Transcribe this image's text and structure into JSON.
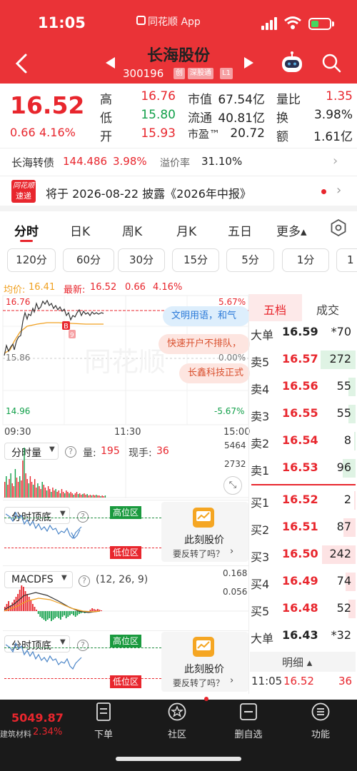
{
  "status_bar": {
    "time": "11:05",
    "app_label": "同花顺 App"
  },
  "header": {
    "back_icon": "back-arrow-icon",
    "stock_name": "长海股份",
    "stock_code": "300196",
    "badges": [
      "创",
      "深股通",
      "L1"
    ]
  },
  "quote": {
    "price": "16.52",
    "change": "0.66",
    "change_pct": "4.16%",
    "rows": [
      {
        "l1": "高",
        "v1": "16.76",
        "l2": "市值",
        "v2": "67.54亿",
        "l3": "量比",
        "v3": "1.35"
      },
      {
        "l1": "低",
        "v1": "15.80",
        "l2": "流通",
        "v2": "40.81亿",
        "l3": "换",
        "v3": "3.98%"
      },
      {
        "l1": "开",
        "v1": "15.93",
        "l2": "市盈™",
        "v2": "20.72",
        "l3": "额",
        "v3": "1.61亿"
      }
    ]
  },
  "convertible": {
    "name": "长海转债",
    "price": "144.486",
    "pct": "3.98%",
    "premium_label": "溢价率",
    "premium": "31.10%"
  },
  "news": {
    "logo_top": "同花顺",
    "logo_bottom": "速递",
    "text": "将于 2026-08-22 披露《2026年中报》"
  },
  "period_tabs": [
    "分时",
    "日K",
    "周K",
    "月K",
    "五日",
    "更多▴"
  ],
  "minute_buttons": [
    "120分",
    "60分",
    "30分",
    "15分",
    "5分",
    "1分",
    "1"
  ],
  "chart": {
    "avg_label": "均价:",
    "avg_value": "16.41",
    "latest_label": "最新:",
    "latest_value": "16.52",
    "latest_change": "0.66",
    "latest_pct": "4.16%",
    "high_price": "16.76",
    "base_price": "15.86",
    "low_price": "14.96",
    "high_pct": "5.67%",
    "zero_pct": "0.00%",
    "low_pct": "-5.67%",
    "marker_b": "B",
    "marker_9": "9",
    "watermark": "同花顺",
    "times": [
      "09:30",
      "11:30",
      "15:00"
    ],
    "ads": [
      "文明用语，和气",
      "快速开户不排队，",
      "长鑫科技正式"
    ]
  },
  "volume_panel": {
    "title": "分时量",
    "vol_label": "量:",
    "vol": "195",
    "now_label": "现手:",
    "now": "36",
    "max": "5464",
    "mid": "2732"
  },
  "indicator1": {
    "title": "分时顶底",
    "high_zone": "高位区",
    "low_zone": "低位区",
    "promo_title": "此刻股价",
    "promo_sub": "要反转了吗？"
  },
  "macd_panel": {
    "title": "MACDFS",
    "params": "(12, 26, 9)",
    "max": "0.168",
    "mid": "0.056"
  },
  "indicator2": {
    "title": "分时顶底",
    "high_zone": "高位区",
    "low_zone": "低位区",
    "promo_title": "此刻股价",
    "promo_sub": "要反转了吗？"
  },
  "order_book": {
    "tabs": [
      "五档",
      "成交"
    ],
    "big_sell": {
      "label": "大单",
      "price": "16.59",
      "vol": "*70"
    },
    "sells": [
      {
        "label": "卖5",
        "price": "16.57",
        "vol": "272",
        "fill": 0.95
      },
      {
        "label": "卖4",
        "price": "16.56",
        "vol": "55",
        "fill": 0.2
      },
      {
        "label": "卖3",
        "price": "16.55",
        "vol": "55",
        "fill": 0.2
      },
      {
        "label": "卖2",
        "price": "16.54",
        "vol": "8",
        "fill": 0.03
      },
      {
        "label": "卖1",
        "price": "16.53",
        "vol": "96",
        "fill": 0.35
      }
    ],
    "buys": [
      {
        "label": "买1",
        "price": "16.52",
        "vol": "2",
        "fill": 0.01
      },
      {
        "label": "买2",
        "price": "16.51",
        "vol": "87",
        "fill": 0.32
      },
      {
        "label": "买3",
        "price": "16.50",
        "vol": "242",
        "fill": 0.9
      },
      {
        "label": "买4",
        "price": "16.49",
        "vol": "74",
        "fill": 0.27
      },
      {
        "label": "买5",
        "price": "16.48",
        "vol": "52",
        "fill": 0.19
      }
    ],
    "big_buy": {
      "label": "大单",
      "price": "16.43",
      "vol": "*32"
    },
    "detail_label": "明细 ▴",
    "trade": {
      "time": "11:05",
      "price": "16.52",
      "vol": "36"
    }
  },
  "bottom_nav": {
    "index_value": "5049.87",
    "index_name": "建筑材料",
    "index_pct": "2.34%",
    "items": [
      "下单",
      "社区",
      "删自选",
      "功能"
    ]
  },
  "colors": {
    "up": "#e8262d",
    "down": "#12a04a",
    "header": "#ea3337",
    "avg_line": "#f0a020"
  }
}
